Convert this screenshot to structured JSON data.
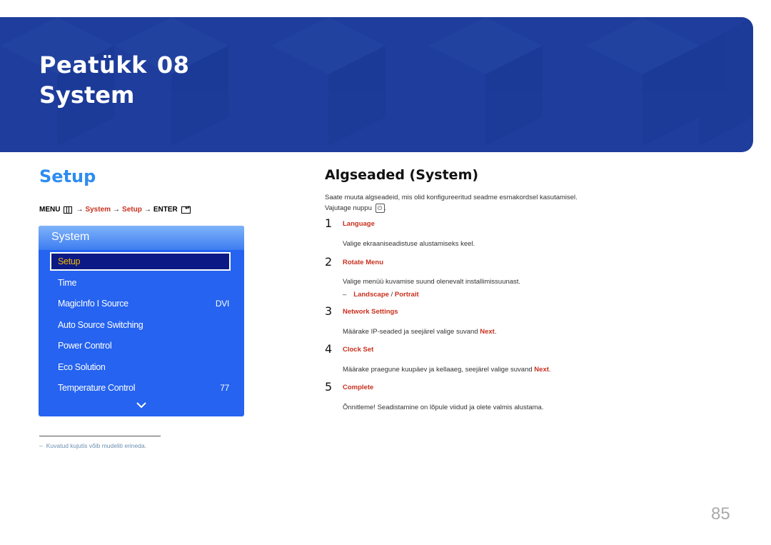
{
  "banner": {
    "chapter_label": "Peatükk",
    "chapter_number": "08",
    "title": "System",
    "color": "#1e3d9c"
  },
  "left": {
    "section_title": "Setup",
    "menu_path": {
      "menu": "MENU",
      "arrow": "→",
      "system": "System",
      "setup": "Setup",
      "enter": "ENTER"
    },
    "osd": {
      "title": "System",
      "items": [
        {
          "label": "Setup",
          "value": "",
          "selected": true
        },
        {
          "label": "Time",
          "value": ""
        },
        {
          "label": "MagicInfo I Source",
          "value": "DVI"
        },
        {
          "label": "Auto Source Switching",
          "value": ""
        },
        {
          "label": "Power Control",
          "value": ""
        },
        {
          "label": "Eco Solution",
          "value": ""
        },
        {
          "label": "Temperature Control",
          "value": "77"
        }
      ],
      "more_icon": "chevron-down-icon"
    },
    "footnote": {
      "dash": "–",
      "text": "Kuvatud kujutis võib mudeliti erineda."
    }
  },
  "right": {
    "title": "Algseaded (System)",
    "intro_line1": "Saate muuta algseadeid, mis olid konfigureeritud seadme esmakordsel kasutamisel.",
    "intro_line2": "Vajutage nuppu",
    "intro_end": ".",
    "power_icon": "power-icon",
    "steps": [
      {
        "num": "1",
        "label": "Language",
        "desc": "Valige ekraaniseadistuse alustamiseks keel."
      },
      {
        "num": "2",
        "label": "Rotate Menu",
        "desc": "Valige menüü kuvamise suund olenevalt installimissuunast.",
        "sub": {
          "dash": "–",
          "opt1": "Landscape",
          "sep": " / ",
          "opt2": "Portrait"
        }
      },
      {
        "num": "3",
        "label": "Network Settings",
        "desc": "Määrake IP-seaded ja seejärel valige suvand ",
        "desc_bold": "Next",
        "desc_end": "."
      },
      {
        "num": "4",
        "label": "Clock Set",
        "desc": "Määrake praegune kuupäev ja kellaaeg, seejärel valige suvand ",
        "desc_bold": "Next",
        "desc_end": "."
      },
      {
        "num": "5",
        "label": "Complete",
        "desc": "Õnnitleme! Seadistamine on lõpule viidud ja olete valmis alustama."
      }
    ]
  },
  "page_number": "85",
  "colors": {
    "accent_red": "#c8301e",
    "section_blue": "#2d8cf0",
    "osd_blue": "#2563f0",
    "osd_selected": "#0c1a85",
    "osd_selected_text": "#f5b800"
  }
}
